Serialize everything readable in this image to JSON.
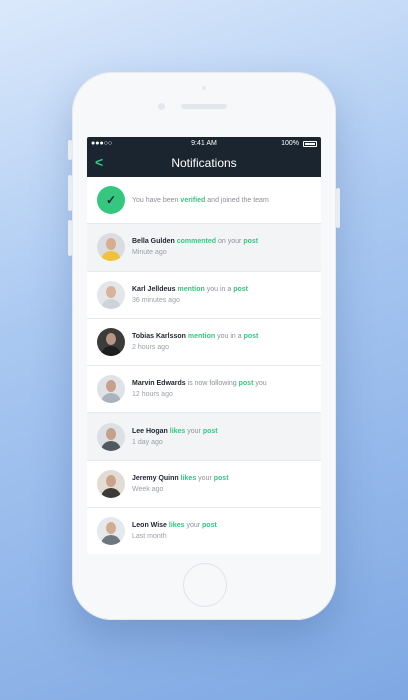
{
  "status_bar": {
    "signal": "●●●○○",
    "time": "9:41 AM",
    "battery": "100%"
  },
  "header": {
    "title": "Notifications",
    "back": "<"
  },
  "verified": {
    "pre": "You have been",
    "highlight": "verified",
    "post": "and joined the team",
    "icon": "check-icon"
  },
  "notifications": [
    {
      "name": "Bella Gulden",
      "action": "commented",
      "mid": "on your",
      "target": "post",
      "time": "Minute ago",
      "shaded": true,
      "colors": {
        "bg": "#d9dde1",
        "body": "#f0c23b",
        "head": "#d8ac8d"
      }
    },
    {
      "name": "Karl Jelldeus",
      "action": "mention",
      "mid": "you in a",
      "target": "post",
      "time": "36 minutes ago",
      "shaded": false,
      "colors": {
        "bg": "#e4e6e9",
        "body": "#cfd3d8",
        "head": "#d9b29b"
      }
    },
    {
      "name": "Tobias Karlsson",
      "action": "mention",
      "mid": "you in a",
      "target": "post",
      "time": "2 hours ago",
      "shaded": false,
      "colors": {
        "bg": "#3b3b3b",
        "body": "#1e1e1e",
        "head": "#b99682"
      }
    },
    {
      "name": "Marvin Edwards",
      "action": "is now following",
      "mid": "",
      "target": "post",
      "tail": "you",
      "plainAction": true,
      "time": "12 hours ago",
      "shaded": false,
      "colors": {
        "bg": "#dfe3e7",
        "body": "#aab3bd",
        "head": "#c8a08a"
      }
    },
    {
      "name": "Lee Hogan",
      "action": "likes",
      "mid": "your",
      "target": "post",
      "time": "1 day ago",
      "shaded": true,
      "colors": {
        "bg": "#dcdfe3",
        "body": "#52585f",
        "head": "#c6a088"
      }
    },
    {
      "name": "Jeremy Quinn",
      "action": "likes",
      "mid": "your",
      "target": "post",
      "time": "Week ago",
      "shaded": false,
      "colors": {
        "bg": "#e2dcd4",
        "body": "#3f3a35",
        "head": "#c9a287"
      }
    },
    {
      "name": "Leon Wise",
      "action": "likes",
      "mid": "your",
      "target": "post",
      "time": "Last month",
      "shaded": false,
      "colors": {
        "bg": "#e5e8ec",
        "body": "#6d7780",
        "head": "#d1ab92"
      }
    }
  ]
}
